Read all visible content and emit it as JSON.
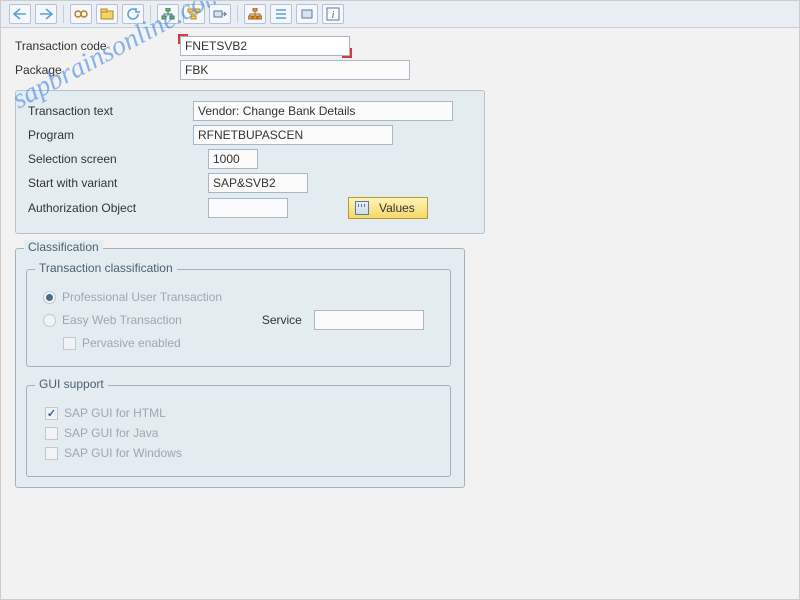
{
  "toolbar": {
    "back": "←",
    "forward": "→",
    "exec": "⚙",
    "display": "🗂",
    "refresh": "↻",
    "tree": "品",
    "align": "≣",
    "where": "▭",
    "info": "i"
  },
  "header": {
    "tcode_label": "Transaction code",
    "tcode_value": "FNETSVB2",
    "package_label": "Package",
    "package_value": "FBK"
  },
  "detail": {
    "text_label": "Transaction text",
    "text_value": "Vendor: Change Bank Details",
    "program_label": "Program",
    "program_value": "RFNETBUPASCEN",
    "selscreen_label": "Selection screen",
    "selscreen_value": "1000",
    "variant_label": "Start with variant",
    "variant_value": "SAP&SVB2",
    "authobj_label": "Authorization Object",
    "authobj_value": "",
    "values_btn": "Values"
  },
  "classification": {
    "legend": "Classification",
    "sub_legend": "Transaction classification",
    "prof": "Professional User Transaction",
    "easy": "Easy Web Transaction",
    "service_label": "Service",
    "service_value": "",
    "pervasive": "Pervasive enabled"
  },
  "gui": {
    "legend": "GUI support",
    "html": "SAP GUI for HTML",
    "java": "SAP GUI for Java",
    "win": "SAP GUI for Windows"
  },
  "watermark": "sapbrainsonline.com"
}
